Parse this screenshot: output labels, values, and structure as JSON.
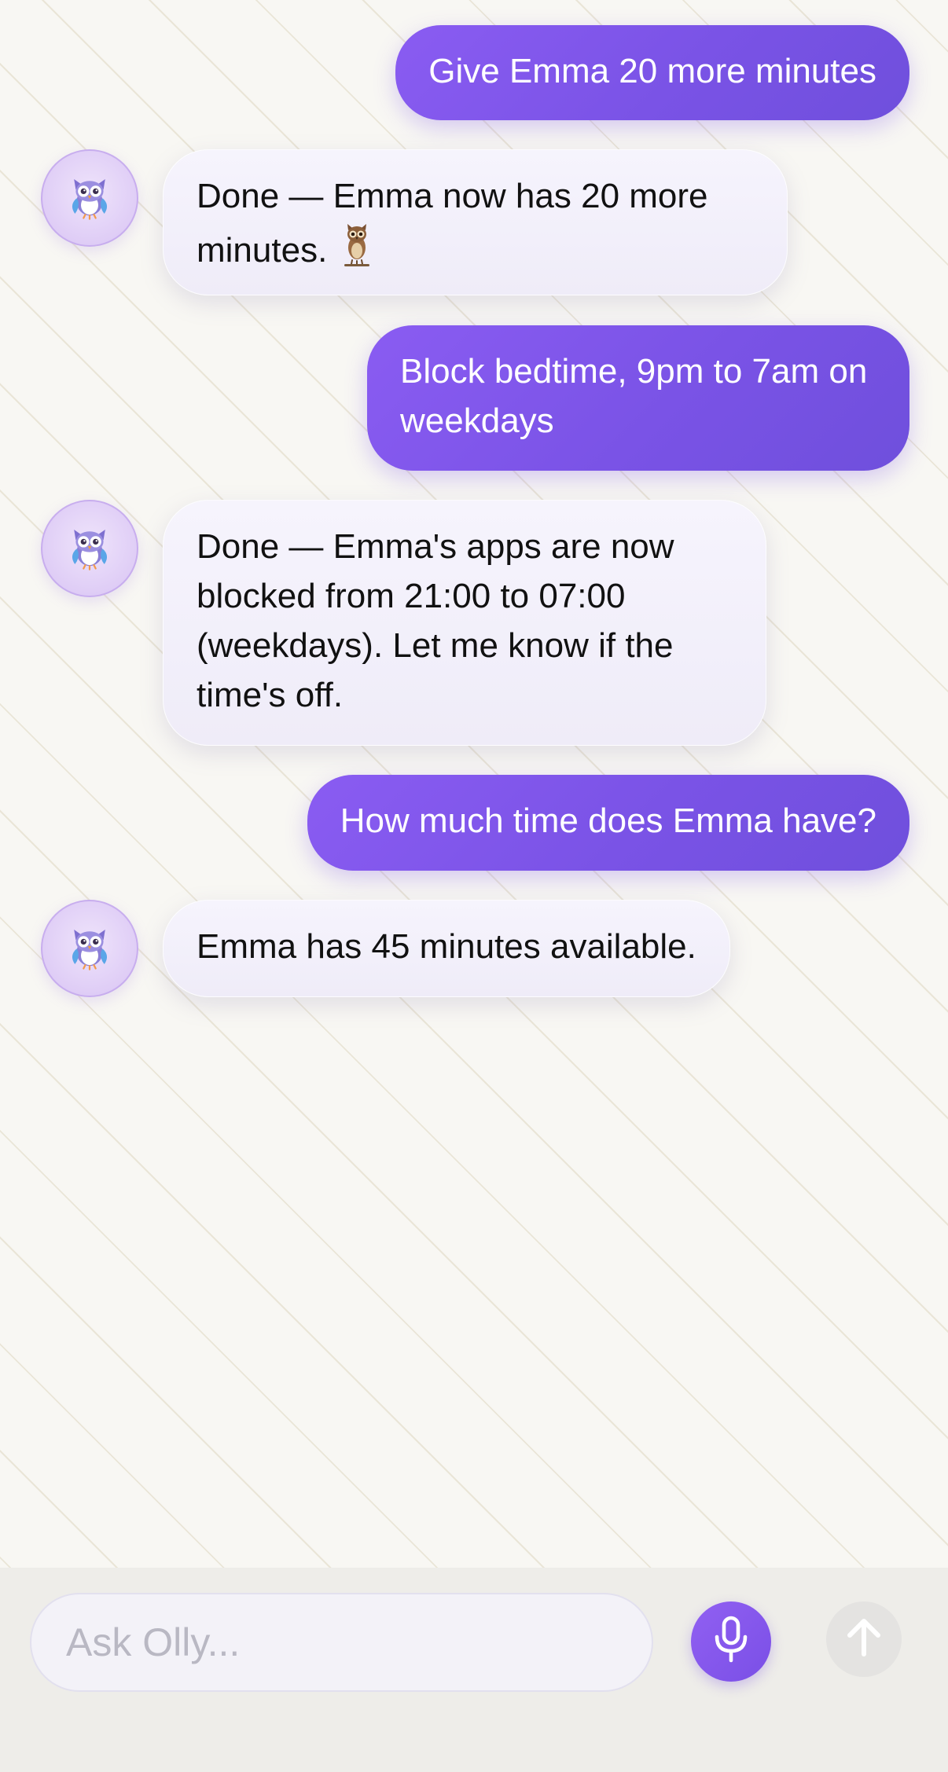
{
  "conversation": {
    "messages": [
      {
        "sender": "user",
        "text": "Give Emma 20 more minutes"
      },
      {
        "sender": "assistant",
        "text": "Done — Emma now has 20 more minutes.",
        "emoji_icon": "owl-icon"
      },
      {
        "sender": "user",
        "text": "Block bedtime, 9pm to 7am on weekdays"
      },
      {
        "sender": "assistant",
        "text": "Done — Emma's apps are now blocked from 21:00 to 07:00 (weekdays). Let me know if the time's off."
      },
      {
        "sender": "user",
        "text": "How much time does Emma have?"
      },
      {
        "sender": "assistant",
        "text": "Emma has 45 minutes available."
      }
    ]
  },
  "composer": {
    "placeholder": "Ask Olly...",
    "mic_icon": "microphone-icon",
    "send_icon": "arrow-up-icon"
  },
  "colors": {
    "accent": "#7a53e6",
    "user_bubble": "#8059ec",
    "assistant_bubble": "#f2f0fa",
    "background": "#f8f7f3",
    "send_disabled": "#e4e3e1"
  }
}
